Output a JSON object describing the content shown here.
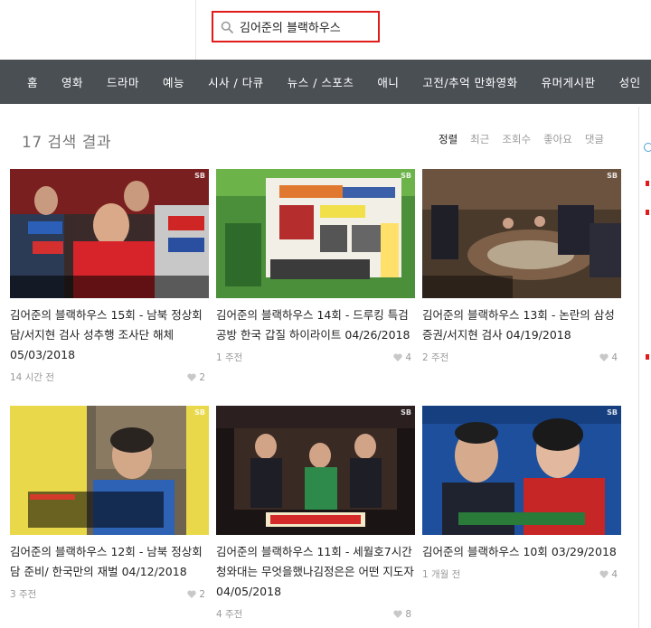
{
  "search": {
    "value": "김어준의 블랙하우스"
  },
  "nav": [
    "홈",
    "영화",
    "드라마",
    "예능",
    "시사 / 다큐",
    "뉴스 / 스포츠",
    "애니",
    "고전/추억 만화영화",
    "유머게시판",
    "성인"
  ],
  "results": {
    "heading": "17 검색 결과"
  },
  "sort": [
    "정렬",
    "최근",
    "조회수",
    "좋아요",
    "댓글"
  ],
  "colors": {
    "accent_red": "#e11a1a",
    "nav_bg": "#4a4f54"
  },
  "icons": {
    "search": "search-icon",
    "heart": "heart-icon"
  },
  "videos": [
    {
      "title": "김어준의 블랙하우스 15회 - 남북 정상회담/서지현 검사 성추행 조사단 해체 05/03/2018",
      "time": "14 시간 전",
      "likes": "2"
    },
    {
      "title": "김어준의 블랙하우스 14회 - 드루킹 특검 공방 한국 갑질 하이라이트 04/26/2018",
      "time": "1 주전",
      "likes": "4"
    },
    {
      "title": "김어준의 블랙하우스 13회 - 논란의 삼성증권/서지현 검사 04/19/2018",
      "time": "2 주전",
      "likes": "4"
    },
    {
      "title": "김어준의 블랙하우스 12회 - 남북 정상회담 준비/ 한국만의 재벌 04/12/2018",
      "time": "3 주전",
      "likes": "2"
    },
    {
      "title": "김어준의 블랙하우스 11회 - 세월호7시간 청와대는 무엇을했나김정은은 어떤 지도자 04/05/2018",
      "time": "4 주전",
      "likes": "8"
    },
    {
      "title": "김어준의 블랙하우스 10회 03/29/2018",
      "time": "1 개월 전",
      "likes": "4"
    }
  ]
}
